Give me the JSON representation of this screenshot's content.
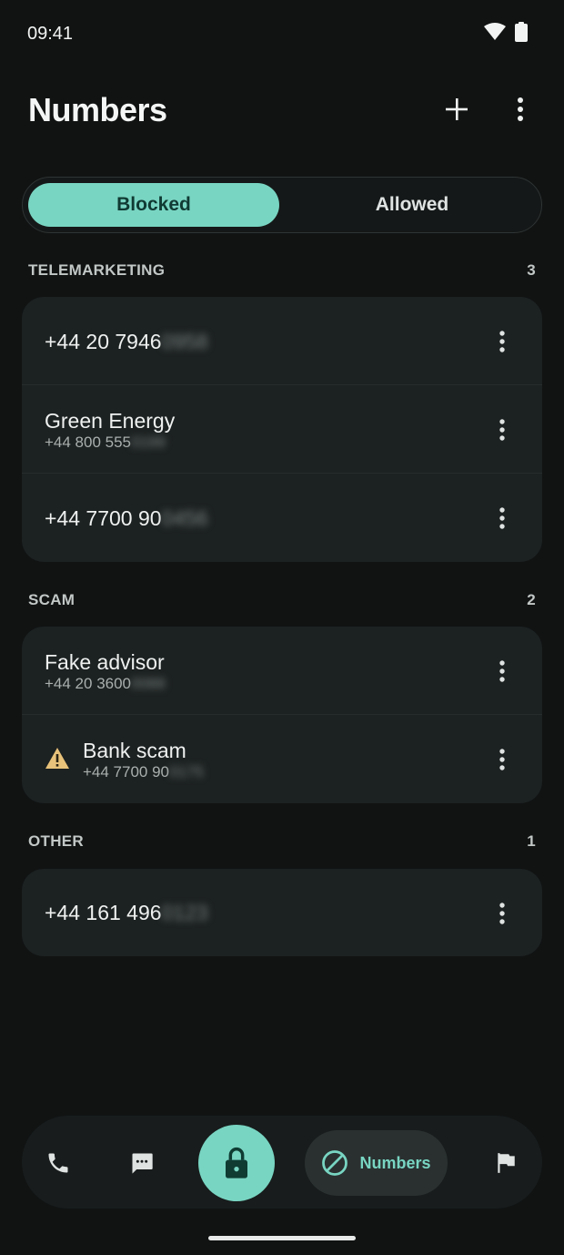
{
  "status_bar": {
    "time": "09:41"
  },
  "header": {
    "title": "Numbers",
    "add_icon": "plus-icon",
    "menu_icon": "more-vert-icon"
  },
  "tabs": {
    "blocked": "Blocked",
    "allowed": "Allowed",
    "selected": "Blocked"
  },
  "sections": [
    {
      "name": "TELEMARKETING",
      "count": "3",
      "items": [
        {
          "title_visible": "+44 20 7946",
          "title_hidden": "0958",
          "sub_visible": "",
          "sub_hidden": ""
        },
        {
          "title_visible": "Green Energy",
          "title_hidden": "",
          "sub_visible": "+44 800 555",
          "sub_hidden": "0199"
        },
        {
          "title_visible": "+44 7700 90",
          "title_hidden": "0456",
          "sub_visible": "",
          "sub_hidden": ""
        }
      ]
    },
    {
      "name": "SCAM",
      "count": "2",
      "items": [
        {
          "title_visible": "Fake advisor",
          "title_hidden": "",
          "sub_visible": "+44 20 3600",
          "sub_hidden": "0088"
        },
        {
          "title_visible": "Bank scam",
          "title_hidden": "",
          "sub_visible": "+44 7700 90",
          "sub_hidden": "0175",
          "warning": true
        }
      ]
    },
    {
      "name": "OTHER",
      "count": "1",
      "items": [
        {
          "title_visible": "+44 161 496",
          "title_hidden": "0123",
          "sub_visible": "",
          "sub_hidden": ""
        }
      ]
    }
  ],
  "bottom_nav": {
    "numbers_label": "Numbers",
    "icons": [
      "phone-icon",
      "message-icon",
      "lock-icon",
      "block-icon",
      "flag-icon"
    ]
  },
  "colors": {
    "accent": "#78d5c2",
    "background": "#111313",
    "card": "#1c2121",
    "warning": "#e8c27a"
  }
}
